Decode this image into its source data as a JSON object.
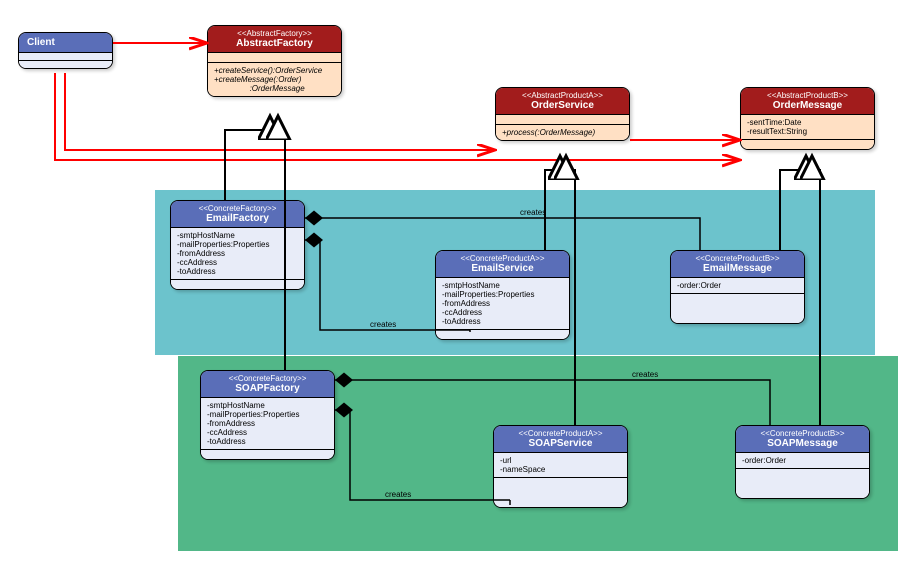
{
  "client": {
    "name": "Client"
  },
  "abstractFactory": {
    "stereo": "<<AbstractFactory>>",
    "name": "AbstractFactory",
    "ops": "+createService():OrderService\n+createMessage(:Order)\n                :OrderMessage"
  },
  "orderService": {
    "stereo": "<<AbstractProductA>>",
    "name": "OrderService",
    "ops": "+process(:OrderMessage)"
  },
  "orderMessage": {
    "stereo": "<<AbstractProductB>>",
    "name": "OrderMessage",
    "attrs": "-sentTime:Date\n-resultText:String"
  },
  "emailFactory": {
    "stereo": "<<ConcreteFactory>>",
    "name": "EmailFactory",
    "attrs": "-smtpHostName\n-mailProperties:Properties\n-fromAddress\n-ccAddress\n-toAddress"
  },
  "emailService": {
    "stereo": "<<ConcreteProductA>>",
    "name": "EmailService",
    "attrs": "-smtpHostName\n-mailProperties:Properties\n-fromAddress\n-ccAddress\n-toAddress"
  },
  "emailMessage": {
    "stereo": "<<ConcreteProductB>>",
    "name": "EmailMessage",
    "attrs": "-order:Order"
  },
  "soapFactory": {
    "stereo": "<<ConcreteFactory>>",
    "name": "SOAPFactory",
    "attrs": "-smtpHostName\n-mailProperties:Properties\n-fromAddress\n-ccAddress\n-toAddress"
  },
  "soapService": {
    "stereo": "<<ConcreteProductA>>",
    "name": "SOAPService",
    "attrs": "-url\n-nameSpace"
  },
  "soapMessage": {
    "stereo": "<<ConcreteProductB>>",
    "name": "SOAPMessage",
    "attrs": "-order:Order"
  },
  "labels": {
    "creates1": "creates",
    "creates2": "creates",
    "creates3": "creates",
    "creates4": "creates"
  }
}
